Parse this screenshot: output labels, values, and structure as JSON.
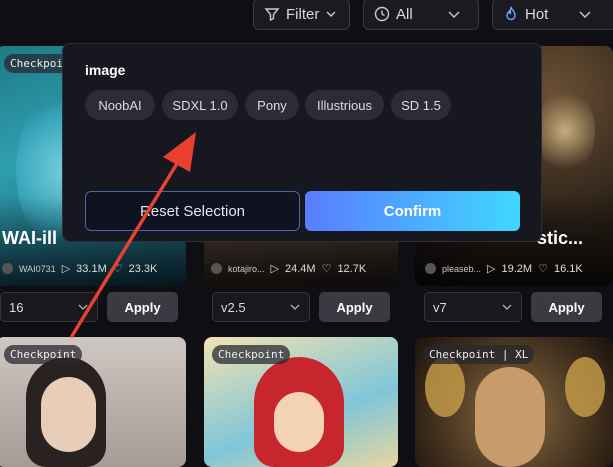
{
  "topbar": {
    "filter_label": "Filter",
    "period_label": "All",
    "sort_label": "Hot"
  },
  "cards_row1": [
    {
      "badge": "Checkpoint",
      "title": "WAI-ill",
      "author": "WAI0731",
      "downloads": "33.1M",
      "likes": "23.3K",
      "version": "16",
      "apply": "Apply"
    },
    {
      "badge": "",
      "title": "",
      "author": "kotajiro...",
      "downloads": "24.4M",
      "likes": "12.7K",
      "version": "v2.5",
      "apply": "Apply"
    },
    {
      "badge": "",
      "title": "stic...",
      "author": "pleaseb...",
      "downloads": "19.2M",
      "likes": "16.1K",
      "version": "v7",
      "apply": "Apply"
    }
  ],
  "cards_row2": [
    {
      "badge": "Checkpoint"
    },
    {
      "badge": "Checkpoint"
    },
    {
      "badge": "Checkpoint | XL"
    }
  ],
  "popup": {
    "section_label": "image",
    "chips": [
      "NoobAI",
      "SDXL 1.0",
      "Pony",
      "Illustrious",
      "SD 1.5"
    ],
    "reset_label": "Reset Selection",
    "confirm_label": "Confirm"
  },
  "colors": {
    "accent_start": "#5a7cff",
    "accent_end": "#3fd8ff",
    "annotation_arrow": "#e8412f"
  }
}
